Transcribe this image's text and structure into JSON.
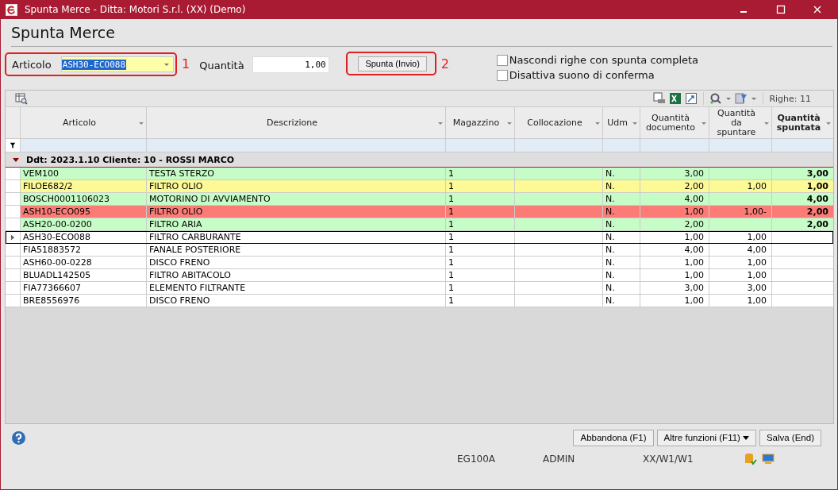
{
  "window": {
    "title": "Spunta Merce - Ditta: Motori S.r.l. (XX)  (Demo)"
  },
  "heading": "Spunta Merce",
  "form": {
    "article_label": "Articolo",
    "article_value": "ASH30-ECO088",
    "quantity_label": "Quantità",
    "quantity_value": "1,00",
    "check_button": "Spunta (Invio)",
    "callouts": [
      "1",
      "2"
    ],
    "options": [
      {
        "label": "Nascondi righe con spunta completa",
        "checked": false
      },
      {
        "label": "Disattiva suono di conferma",
        "checked": false
      }
    ]
  },
  "grid": {
    "row_count": "Righe: 11",
    "columns": [
      "Articolo",
      "Descrizione",
      "Magazzino",
      "Collocazione",
      "Udm",
      "Quantità documento",
      "Quantità da spuntare",
      "Quantità spuntata"
    ],
    "group": {
      "label": "Ddt: 2023.1.10 Cliente: 10 - ROSSI MARCO",
      "expanded": true
    },
    "rows": [
      {
        "cells": [
          "VEM100",
          "TESTA STERZO",
          "1",
          "",
          "N.",
          "3,00",
          "",
          "3,00"
        ],
        "color": "#c6fcc6",
        "selected": false
      },
      {
        "cells": [
          "FILOE682/2",
          "FILTRO OLIO",
          "1",
          "",
          "N.",
          "2,00",
          "1,00",
          "1,00"
        ],
        "color": "#fdfa96",
        "selected": false
      },
      {
        "cells": [
          "BOSCH0001106023",
          "MOTORINO DI AVVIAMENTO",
          "1",
          "",
          "N.",
          "4,00",
          "",
          "4,00"
        ],
        "color": "#c6fcc6",
        "selected": false
      },
      {
        "cells": [
          "ASH10-ECO095",
          "FILTRO OLIO",
          "1",
          "",
          "N.",
          "1,00",
          "1,00-",
          "2,00"
        ],
        "color": "#fd7b76",
        "selected": false
      },
      {
        "cells": [
          "ASH20-00-0200",
          "FILTRO ARIA",
          "1",
          "",
          "N.",
          "2,00",
          "",
          "2,00"
        ],
        "color": "#c6fcc6",
        "selected": false
      },
      {
        "cells": [
          "ASH30-ECO088",
          "FILTRO CARBURANTE",
          "1",
          "",
          "N.",
          "1,00",
          "1,00",
          ""
        ],
        "color": "#ffffff",
        "selected": true
      },
      {
        "cells": [
          "FIA51883572",
          "FANALE POSTERIORE",
          "1",
          "",
          "N.",
          "4,00",
          "4,00",
          ""
        ],
        "color": "#ffffff",
        "selected": false
      },
      {
        "cells": [
          "ASH60-00-0228",
          "DISCO FRENO",
          "1",
          "",
          "N.",
          "1,00",
          "1,00",
          ""
        ],
        "color": "#ffffff",
        "selected": false
      },
      {
        "cells": [
          "BLUADL142505",
          "FILTRO ABITACOLO",
          "1",
          "",
          "N.",
          "1,00",
          "1,00",
          ""
        ],
        "color": "#ffffff",
        "selected": false
      },
      {
        "cells": [
          "FIA77366607",
          "ELEMENTO FILTRANTE",
          "1",
          "",
          "N.",
          "3,00",
          "3,00",
          ""
        ],
        "color": "#ffffff",
        "selected": false
      },
      {
        "cells": [
          "BRE8556976",
          "DISCO FRENO",
          "1",
          "",
          "N.",
          "1,00",
          "1,00",
          ""
        ],
        "color": "#ffffff",
        "selected": false
      }
    ]
  },
  "buttons": [
    "Abbandona (F1)",
    "Altre funzioni (F11)",
    "Salva (End)"
  ],
  "status_bar": [
    "EG100A",
    "ADMIN",
    "XX/W1/W1"
  ]
}
